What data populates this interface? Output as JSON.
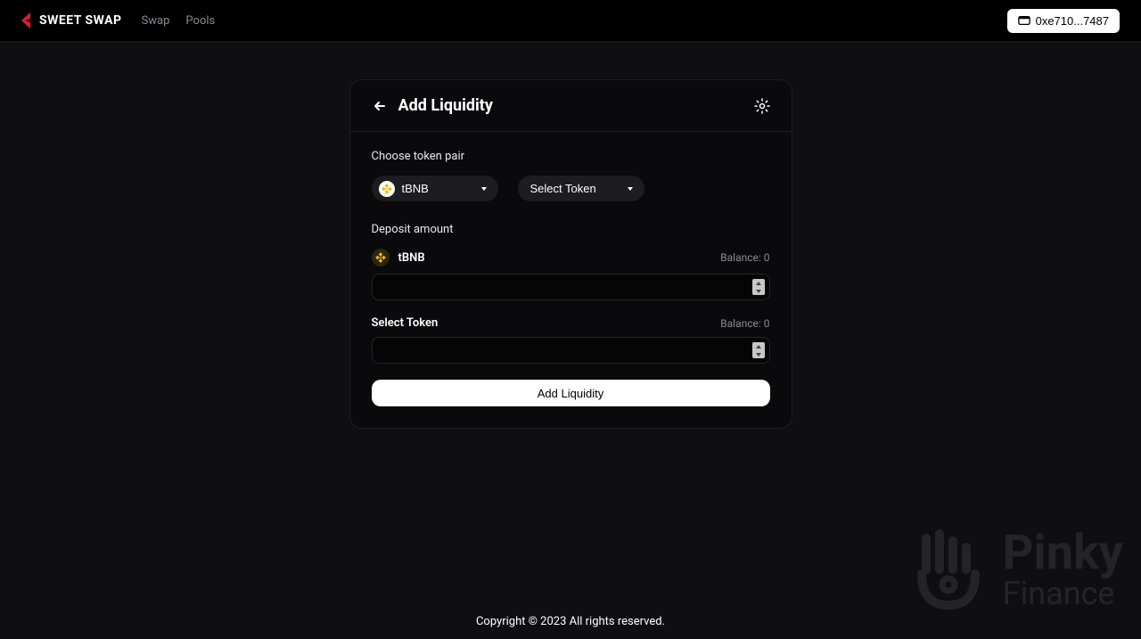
{
  "header": {
    "brand": "SWEET SWAP",
    "nav": {
      "swap": "Swap",
      "pools": "Pools"
    },
    "wallet": "0xe710...7487"
  },
  "card": {
    "title": "Add Liquidity",
    "choose_label": "Choose token pair",
    "token_a": "tBNB",
    "token_b": "Select Token",
    "deposit_label": "Deposit amount",
    "deposit_a": {
      "symbol": "tBNB",
      "balance_label": "Balance: 0"
    },
    "deposit_b": {
      "symbol": "Select Token",
      "balance_label": "Balance: 0"
    },
    "submit": "Add Liquidity"
  },
  "footer": "Copyright © 2023 All rights reserved.",
  "watermark": {
    "line1": "Pinky",
    "line2": "Finance"
  }
}
